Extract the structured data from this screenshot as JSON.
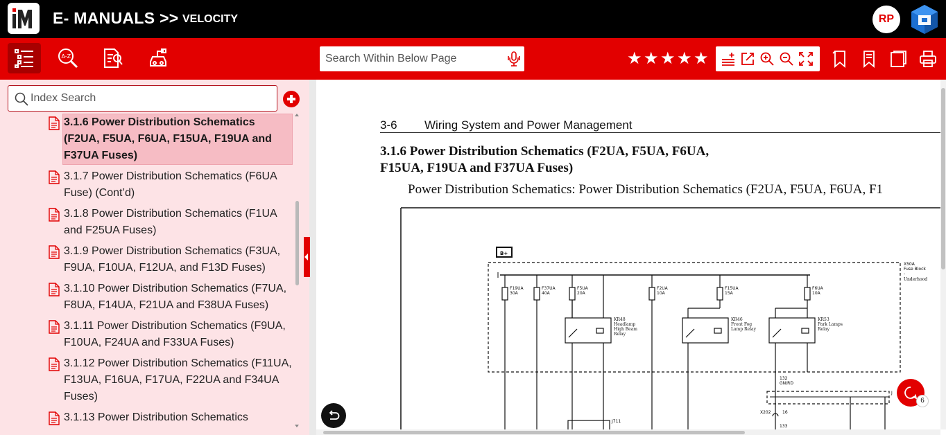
{
  "header": {
    "logo_text": "iM",
    "app_title": "E- MANUALS >>",
    "manual_name": "VELOCITY",
    "user_initials": "RP",
    "app_icon": "cube-logo-icon",
    "colors": {
      "brand_red": "#e20000",
      "header_bg": "#000000",
      "panel_bg": "#fde3e6",
      "selected_bg": "#f6bcc4"
    }
  },
  "left_toolbar": {
    "buttons": [
      {
        "icon": "toc-list-icon",
        "active": true
      },
      {
        "icon": "a-z-search-icon",
        "active": false
      },
      {
        "icon": "document-search-icon",
        "active": false
      },
      {
        "icon": "vehicle-diagnostic-icon",
        "active": false
      }
    ]
  },
  "index": {
    "search_placeholder": "Index Search",
    "items": [
      {
        "label": "3.1.6 Power Distribution Schematics (F2UA, F5UA, F6UA, F15UA, F19UA and F37UA Fuses)",
        "selected": true
      },
      {
        "label": "3.1.7 Power Distribution Schematics (F6UA Fuse) (Cont’d)",
        "selected": false
      },
      {
        "label": "3.1.8 Power Distribution Schematics (F1UA and F25UA Fuses)",
        "selected": false
      },
      {
        "label": "3.1.9 Power Distribution Schematics (F3UA, F9UA, F10UA, F12UA, and F13D Fuses)",
        "selected": false
      },
      {
        "label": "3.1.10 Power Distribution Schematics (F7UA, F8UA, F14UA, F21UA and F38UA Fuses)",
        "selected": false
      },
      {
        "label": "3.1.11 Power Distribution Schematics (F9UA, F10UA, F24UA and F33UA Fuses)",
        "selected": false
      },
      {
        "label": "3.1.12 Power Distribution Schematics (F11UA, F13UA, F16UA, F17UA, F22UA and F34UA Fuses)",
        "selected": false
      },
      {
        "label": "3.1.13 Power Distribution Schematics",
        "selected": false
      }
    ]
  },
  "viewer_toolbar": {
    "search_placeholder": "Search Within Below Page",
    "rating_stars": 5,
    "tools": [
      "add-note-icon",
      "edit-icon",
      "zoom-in-icon",
      "zoom-out-icon",
      "fit-screen-icon"
    ],
    "actions": [
      "bookmark-icon",
      "bookmark-list-icon",
      "notes-icon",
      "print-icon"
    ]
  },
  "document": {
    "page_number": "3-6",
    "section_header": "Wiring System and Power Management",
    "title": "3.1.6 Power Distribution Schematics (F2UA, F5UA, F6UA, F15UA, F19UA and F37UA Fuses)",
    "caption": "Power Distribution Schematics: Power Distribution Schematics (F2UA, F5UA, F6UA, F1",
    "schematic": {
      "battery_label": "B+",
      "fuse_block": {
        "name": "X50A",
        "line1": "Fuse Block",
        "line2": "-",
        "line3": "Underhood"
      },
      "fuses": [
        {
          "name": "F19UA",
          "rating": "30A"
        },
        {
          "name": "F37UA",
          "rating": "40A"
        },
        {
          "name": "F5UA",
          "rating": "20A"
        },
        {
          "name": "F2UA",
          "rating": "10A"
        },
        {
          "name": "F15UA",
          "rating": "15A"
        },
        {
          "name": "F6UA",
          "rating": "10A"
        }
      ],
      "relays": [
        {
          "name": "KR48",
          "line1": "Headlamp",
          "line2": "High Beam",
          "line3": "Relay"
        },
        {
          "name": "KR46",
          "line1": "Front Fog",
          "line2": "Lamp Relay"
        },
        {
          "name": "KR53",
          "line1": "Park Lamps",
          "line2": "Relay"
        }
      ],
      "wire_circuit": "132",
      "wire_color": "GN/RD",
      "connector": "X202",
      "connector_pin": "16",
      "lower_connector": "J711",
      "lower_circuit": "133",
      "j_label": "J"
    }
  },
  "chat": {
    "badge_count": "6"
  }
}
